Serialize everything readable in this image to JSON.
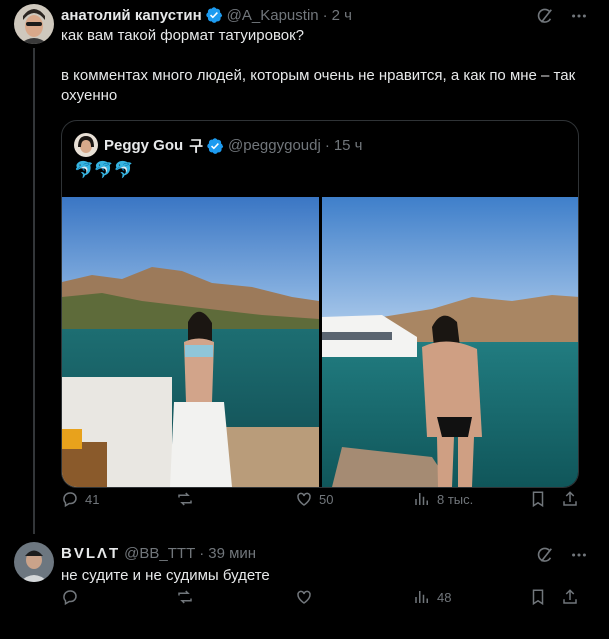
{
  "tweet1": {
    "author_name": "анатолий капустин",
    "handle": "@A_Kapustin",
    "separator": "·",
    "time": "2 ч",
    "text_line1": "как вам такой формат татуировок?",
    "text_line2": "в комментах много людей, которым очень не нравится, а как по мне – так охуенно",
    "stats": {
      "replies": "41",
      "reposts": "",
      "likes": "50",
      "views": "8 тыс."
    }
  },
  "quote": {
    "author_name": "Peggy Gou",
    "name_suffix": "구",
    "handle": "@peggygoudj",
    "separator": "·",
    "time": "15 ч",
    "emoji": "🐬🐬🐬"
  },
  "tweet2": {
    "author_name": "BVLΛT",
    "handle": "@BB_TTT",
    "separator": "·",
    "time": "39 мин",
    "text": "не судите и не судимы будете",
    "stats": {
      "replies": "",
      "reposts": "",
      "likes": "",
      "views": "48"
    }
  },
  "colors": {
    "background": "#000000",
    "text": "#e7e9ea",
    "muted": "#71767b",
    "verified": "#1d9bf0",
    "border": "#2f3336"
  }
}
